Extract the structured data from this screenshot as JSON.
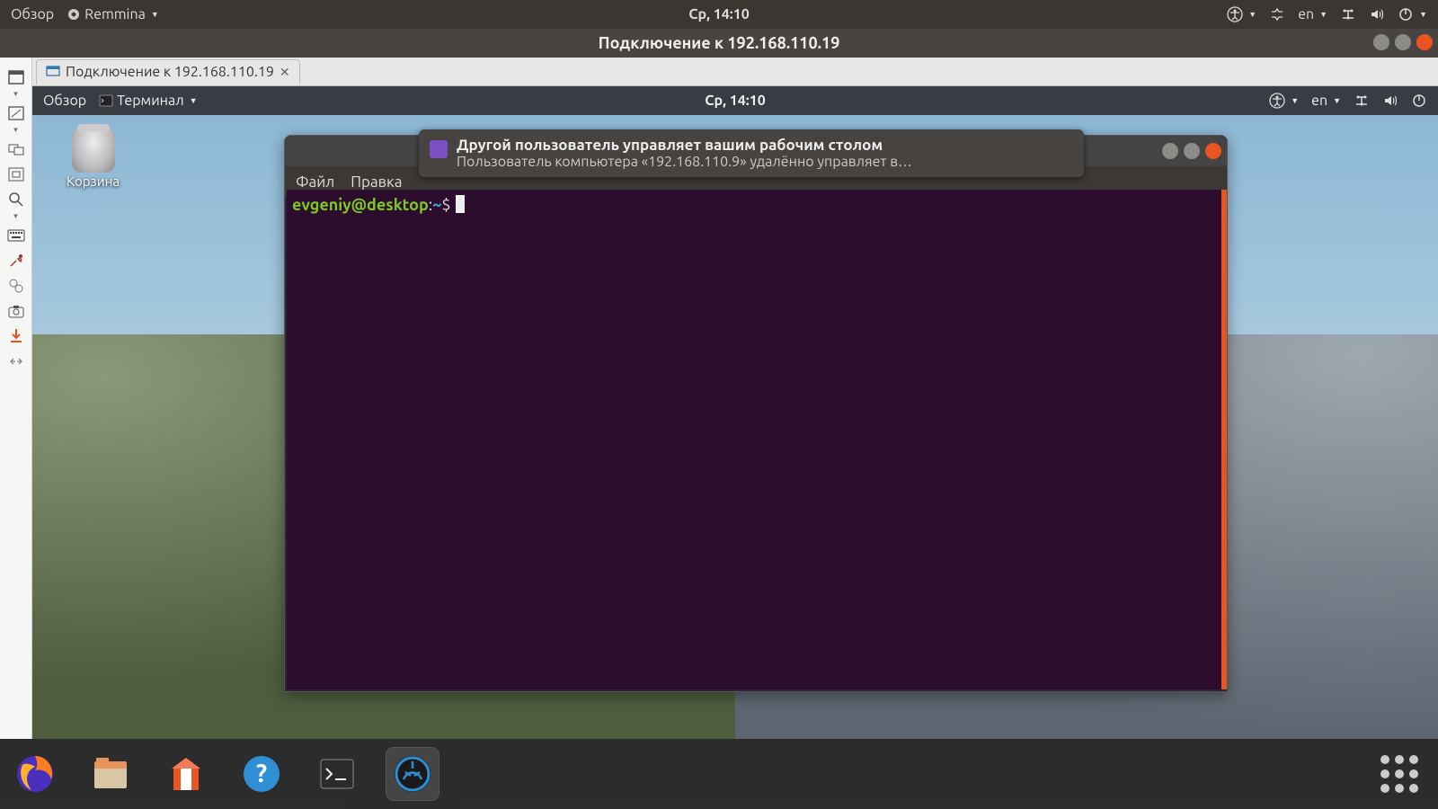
{
  "host_panel": {
    "activities": "Обзор",
    "app_name": "Remmina",
    "clock": "Ср, 14:10",
    "lang": "en"
  },
  "remmina_window": {
    "title": "Подключение к 192.168.110.19",
    "tab_label": "Подключение к 192.168.110.19"
  },
  "remote_panel": {
    "activities": "Обзор",
    "app_name": "Терминал",
    "clock": "Ср, 14:10",
    "lang": "en"
  },
  "remote_desktop": {
    "trash_label": "Корзина"
  },
  "terminal": {
    "menus": {
      "file": "Файл",
      "edit": "Правка"
    },
    "prompt": {
      "user": "evgeniy",
      "at": "@",
      "host": "desktop",
      "sep": ":",
      "path": "~",
      "symbol": "$"
    }
  },
  "notification": {
    "title": "Другой пользователь управляет вашим рабочим столом",
    "body": "Пользователь компьютера «192.168.110.9» удалённо управляет в…"
  },
  "dock": {
    "apps": [
      "firefox",
      "files",
      "software",
      "help",
      "terminal",
      "remmina"
    ]
  }
}
